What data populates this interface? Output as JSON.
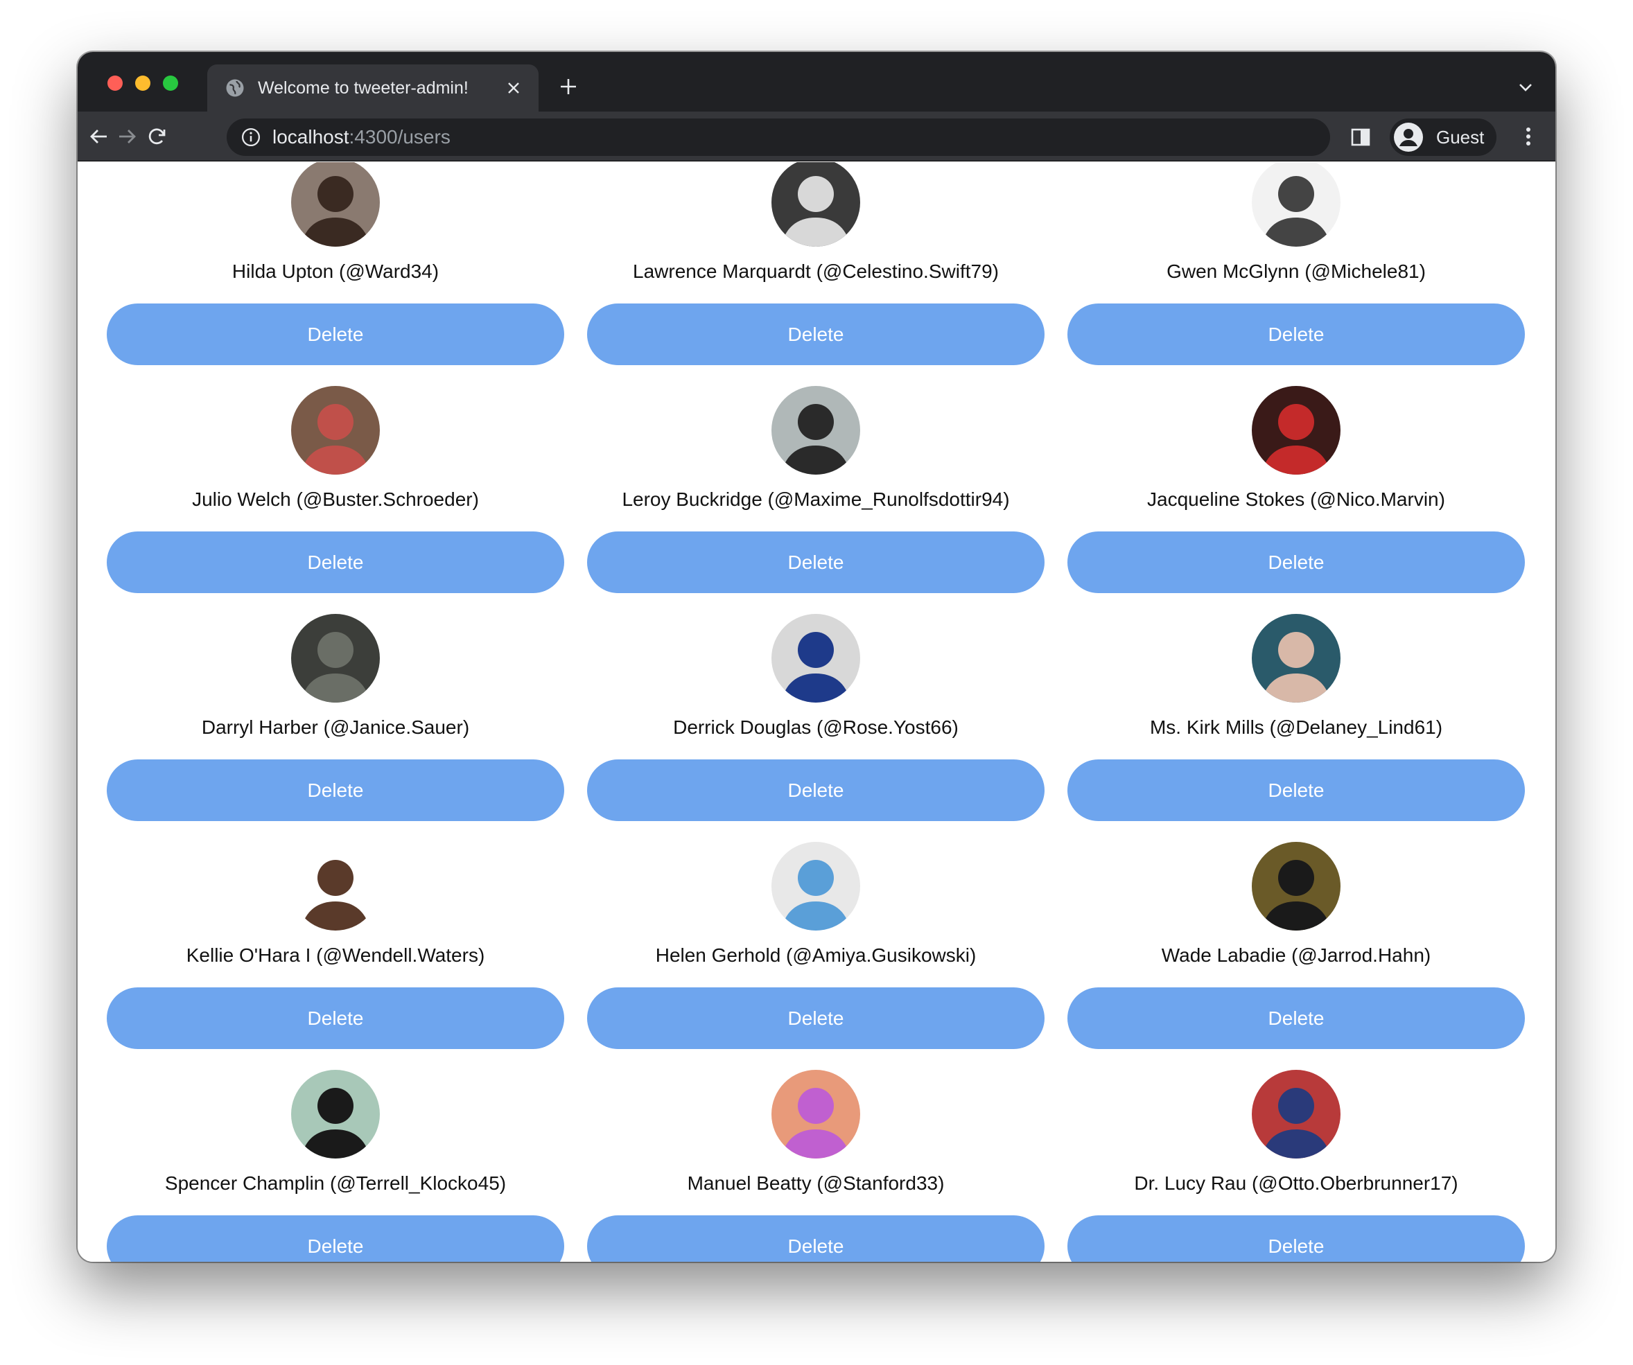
{
  "browser": {
    "tab_title": "Welcome to tweeter-admin!",
    "url_host": "localhost",
    "url_path": ":4300/users",
    "profile_label": "Guest"
  },
  "users": [
    {
      "label": "Hilda Upton (@Ward34)",
      "delete_label": "Delete",
      "avatar_bg": "#8a7a70",
      "avatar_fg": "#3a2a22"
    },
    {
      "label": "Lawrence Marquardt (@Celestino.Swift79)",
      "delete_label": "Delete",
      "avatar_bg": "#3a3a3a",
      "avatar_fg": "#d8d8d8"
    },
    {
      "label": "Gwen McGlynn (@Michele81)",
      "delete_label": "Delete",
      "avatar_bg": "#f2f2f2",
      "avatar_fg": "#444444"
    },
    {
      "label": "Julio Welch (@Buster.Schroeder)",
      "delete_label": "Delete",
      "avatar_bg": "#7a5a48",
      "avatar_fg": "#c0504a"
    },
    {
      "label": "Leroy Buckridge (@Maxime_Runolfsdottir94)",
      "delete_label": "Delete",
      "avatar_bg": "#b0b8b8",
      "avatar_fg": "#2a2a2a"
    },
    {
      "label": "Jacqueline Stokes (@Nico.Marvin)",
      "delete_label": "Delete",
      "avatar_bg": "#3a1a18",
      "avatar_fg": "#c42a2a"
    },
    {
      "label": "Darryl Harber (@Janice.Sauer)",
      "delete_label": "Delete",
      "avatar_bg": "#3c3e3a",
      "avatar_fg": "#6a6e66"
    },
    {
      "label": "Derrick Douglas (@Rose.Yost66)",
      "delete_label": "Delete",
      "avatar_bg": "#d8d8d8",
      "avatar_fg": "#1e3a8a"
    },
    {
      "label": "Ms. Kirk Mills (@Delaney_Lind61)",
      "delete_label": "Delete",
      "avatar_bg": "#2a5a6a",
      "avatar_fg": "#d8b8a8"
    },
    {
      "label": "Kellie O'Hara I (@Wendell.Waters)",
      "delete_label": "Delete",
      "avatar_bg": "#ffffff",
      "avatar_fg": "#5a3a2a"
    },
    {
      "label": "Helen Gerhold (@Amiya.Gusikowski)",
      "delete_label": "Delete",
      "avatar_bg": "#e8e8e8",
      "avatar_fg": "#5a9fd8"
    },
    {
      "label": "Wade Labadie (@Jarrod.Hahn)",
      "delete_label": "Delete",
      "avatar_bg": "#6a5a28",
      "avatar_fg": "#1a1a1a"
    },
    {
      "label": "Spencer Champlin (@Terrell_Klocko45)",
      "delete_label": "Delete",
      "avatar_bg": "#a8c8b8",
      "avatar_fg": "#1a1a1a"
    },
    {
      "label": "Manuel Beatty (@Stanford33)",
      "delete_label": "Delete",
      "avatar_bg": "#e89a7a",
      "avatar_fg": "#c060d0"
    },
    {
      "label": "Dr. Lucy Rau (@Otto.Oberbrunner17)",
      "delete_label": "Delete",
      "avatar_bg": "#b83a3a",
      "avatar_fg": "#2a3a7a"
    }
  ],
  "colors": {
    "accent": "#6ea5ee",
    "chrome_dark": "#202124",
    "chrome_mid": "#35363a"
  }
}
